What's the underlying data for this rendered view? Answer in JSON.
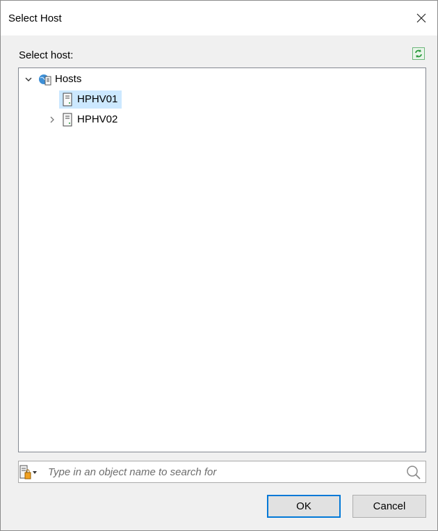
{
  "window": {
    "title": "Select Host",
    "close_glyph": "✕"
  },
  "section_label": "Select host:",
  "refresh_icon": "refresh-icon",
  "tree": {
    "root": {
      "label": "Hosts",
      "expanded": true,
      "icon": "hosts-globe-icon"
    },
    "items": [
      {
        "label": "HPHV01",
        "selected": true,
        "expandable": false,
        "icon": "server-icon"
      },
      {
        "label": "HPHV02",
        "selected": false,
        "expandable": true,
        "icon": "server-icon"
      }
    ]
  },
  "search": {
    "placeholder": "Type in an object name to search for",
    "value": ""
  },
  "buttons": {
    "ok": "OK",
    "cancel": "Cancel"
  },
  "colors": {
    "selection": "#cce8ff",
    "accent": "#0078d7",
    "refresh_green": "#2a9a3c"
  }
}
